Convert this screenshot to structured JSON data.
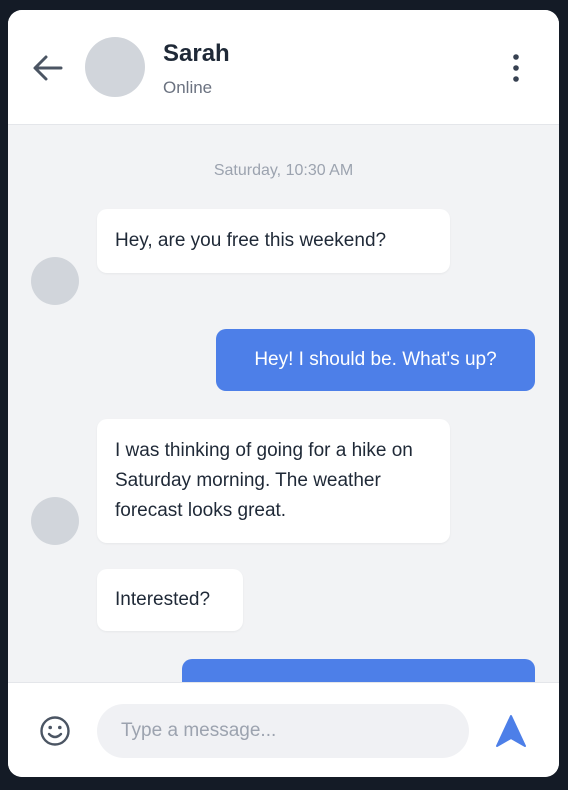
{
  "header": {
    "contact_name": "Sarah",
    "contact_status": "Online",
    "back_icon": "arrow-left-icon",
    "menu_icon": "kebab-menu-icon"
  },
  "conversation": {
    "date_separator": "Saturday, 10:30 AM",
    "messages": [
      {
        "sender": "Sarah",
        "direction": "incoming",
        "text": "Hey, are you free this weekend?"
      },
      {
        "sender": "me",
        "direction": "outgoing",
        "text": "Hey! I should be. What's up?"
      },
      {
        "sender": "Sarah",
        "direction": "incoming",
        "text": "I was thinking of going for a hike on Saturday morning. The weather forecast looks great."
      },
      {
        "sender": "Sarah",
        "direction": "incoming",
        "text": "Interested?"
      },
      {
        "sender": "me",
        "direction": "outgoing",
        "text": ""
      }
    ]
  },
  "composer": {
    "placeholder": "Type a message...",
    "value": "",
    "emoji_icon": "smiley-icon",
    "send_icon": "send-icon"
  },
  "colors": {
    "accent": "#4d7fe8",
    "background": "#f2f3f5",
    "incoming_bubble": "#ffffff",
    "avatar_placeholder": "#d1d5db"
  }
}
